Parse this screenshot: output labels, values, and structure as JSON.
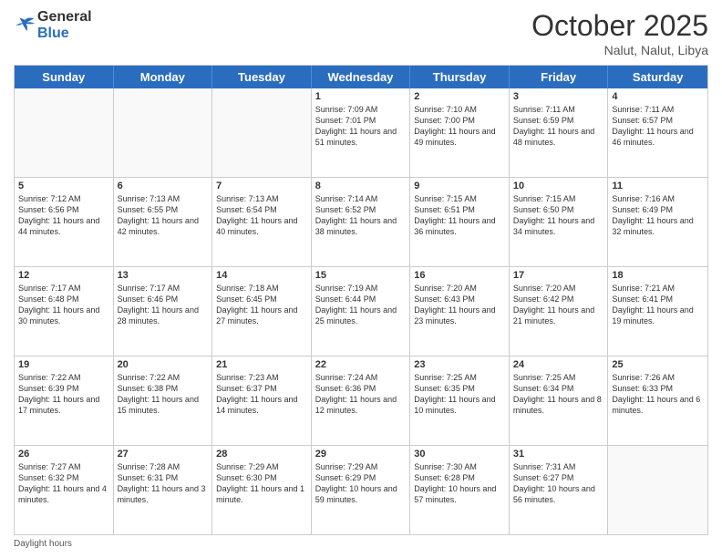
{
  "header": {
    "logo_general": "General",
    "logo_blue": "Blue",
    "month": "October 2025",
    "location": "Nalut, Nalut, Libya"
  },
  "day_headers": [
    "Sunday",
    "Monday",
    "Tuesday",
    "Wednesday",
    "Thursday",
    "Friday",
    "Saturday"
  ],
  "rows": [
    [
      {
        "date": "",
        "info": ""
      },
      {
        "date": "",
        "info": ""
      },
      {
        "date": "",
        "info": ""
      },
      {
        "date": "1",
        "info": "Sunrise: 7:09 AM\nSunset: 7:01 PM\nDaylight: 11 hours and 51 minutes."
      },
      {
        "date": "2",
        "info": "Sunrise: 7:10 AM\nSunset: 7:00 PM\nDaylight: 11 hours and 49 minutes."
      },
      {
        "date": "3",
        "info": "Sunrise: 7:11 AM\nSunset: 6:59 PM\nDaylight: 11 hours and 48 minutes."
      },
      {
        "date": "4",
        "info": "Sunrise: 7:11 AM\nSunset: 6:57 PM\nDaylight: 11 hours and 46 minutes."
      }
    ],
    [
      {
        "date": "5",
        "info": "Sunrise: 7:12 AM\nSunset: 6:56 PM\nDaylight: 11 hours and 44 minutes."
      },
      {
        "date": "6",
        "info": "Sunrise: 7:13 AM\nSunset: 6:55 PM\nDaylight: 11 hours and 42 minutes."
      },
      {
        "date": "7",
        "info": "Sunrise: 7:13 AM\nSunset: 6:54 PM\nDaylight: 11 hours and 40 minutes."
      },
      {
        "date": "8",
        "info": "Sunrise: 7:14 AM\nSunset: 6:52 PM\nDaylight: 11 hours and 38 minutes."
      },
      {
        "date": "9",
        "info": "Sunrise: 7:15 AM\nSunset: 6:51 PM\nDaylight: 11 hours and 36 minutes."
      },
      {
        "date": "10",
        "info": "Sunrise: 7:15 AM\nSunset: 6:50 PM\nDaylight: 11 hours and 34 minutes."
      },
      {
        "date": "11",
        "info": "Sunrise: 7:16 AM\nSunset: 6:49 PM\nDaylight: 11 hours and 32 minutes."
      }
    ],
    [
      {
        "date": "12",
        "info": "Sunrise: 7:17 AM\nSunset: 6:48 PM\nDaylight: 11 hours and 30 minutes."
      },
      {
        "date": "13",
        "info": "Sunrise: 7:17 AM\nSunset: 6:46 PM\nDaylight: 11 hours and 28 minutes."
      },
      {
        "date": "14",
        "info": "Sunrise: 7:18 AM\nSunset: 6:45 PM\nDaylight: 11 hours and 27 minutes."
      },
      {
        "date": "15",
        "info": "Sunrise: 7:19 AM\nSunset: 6:44 PM\nDaylight: 11 hours and 25 minutes."
      },
      {
        "date": "16",
        "info": "Sunrise: 7:20 AM\nSunset: 6:43 PM\nDaylight: 11 hours and 23 minutes."
      },
      {
        "date": "17",
        "info": "Sunrise: 7:20 AM\nSunset: 6:42 PM\nDaylight: 11 hours and 21 minutes."
      },
      {
        "date": "18",
        "info": "Sunrise: 7:21 AM\nSunset: 6:41 PM\nDaylight: 11 hours and 19 minutes."
      }
    ],
    [
      {
        "date": "19",
        "info": "Sunrise: 7:22 AM\nSunset: 6:39 PM\nDaylight: 11 hours and 17 minutes."
      },
      {
        "date": "20",
        "info": "Sunrise: 7:22 AM\nSunset: 6:38 PM\nDaylight: 11 hours and 15 minutes."
      },
      {
        "date": "21",
        "info": "Sunrise: 7:23 AM\nSunset: 6:37 PM\nDaylight: 11 hours and 14 minutes."
      },
      {
        "date": "22",
        "info": "Sunrise: 7:24 AM\nSunset: 6:36 PM\nDaylight: 11 hours and 12 minutes."
      },
      {
        "date": "23",
        "info": "Sunrise: 7:25 AM\nSunset: 6:35 PM\nDaylight: 11 hours and 10 minutes."
      },
      {
        "date": "24",
        "info": "Sunrise: 7:25 AM\nSunset: 6:34 PM\nDaylight: 11 hours and 8 minutes."
      },
      {
        "date": "25",
        "info": "Sunrise: 7:26 AM\nSunset: 6:33 PM\nDaylight: 11 hours and 6 minutes."
      }
    ],
    [
      {
        "date": "26",
        "info": "Sunrise: 7:27 AM\nSunset: 6:32 PM\nDaylight: 11 hours and 4 minutes."
      },
      {
        "date": "27",
        "info": "Sunrise: 7:28 AM\nSunset: 6:31 PM\nDaylight: 11 hours and 3 minutes."
      },
      {
        "date": "28",
        "info": "Sunrise: 7:29 AM\nSunset: 6:30 PM\nDaylight: 11 hours and 1 minute."
      },
      {
        "date": "29",
        "info": "Sunrise: 7:29 AM\nSunset: 6:29 PM\nDaylight: 10 hours and 59 minutes."
      },
      {
        "date": "30",
        "info": "Sunrise: 7:30 AM\nSunset: 6:28 PM\nDaylight: 10 hours and 57 minutes."
      },
      {
        "date": "31",
        "info": "Sunrise: 7:31 AM\nSunset: 6:27 PM\nDaylight: 10 hours and 56 minutes."
      },
      {
        "date": "",
        "info": ""
      }
    ]
  ],
  "footer": {
    "daylight_hours": "Daylight hours"
  }
}
